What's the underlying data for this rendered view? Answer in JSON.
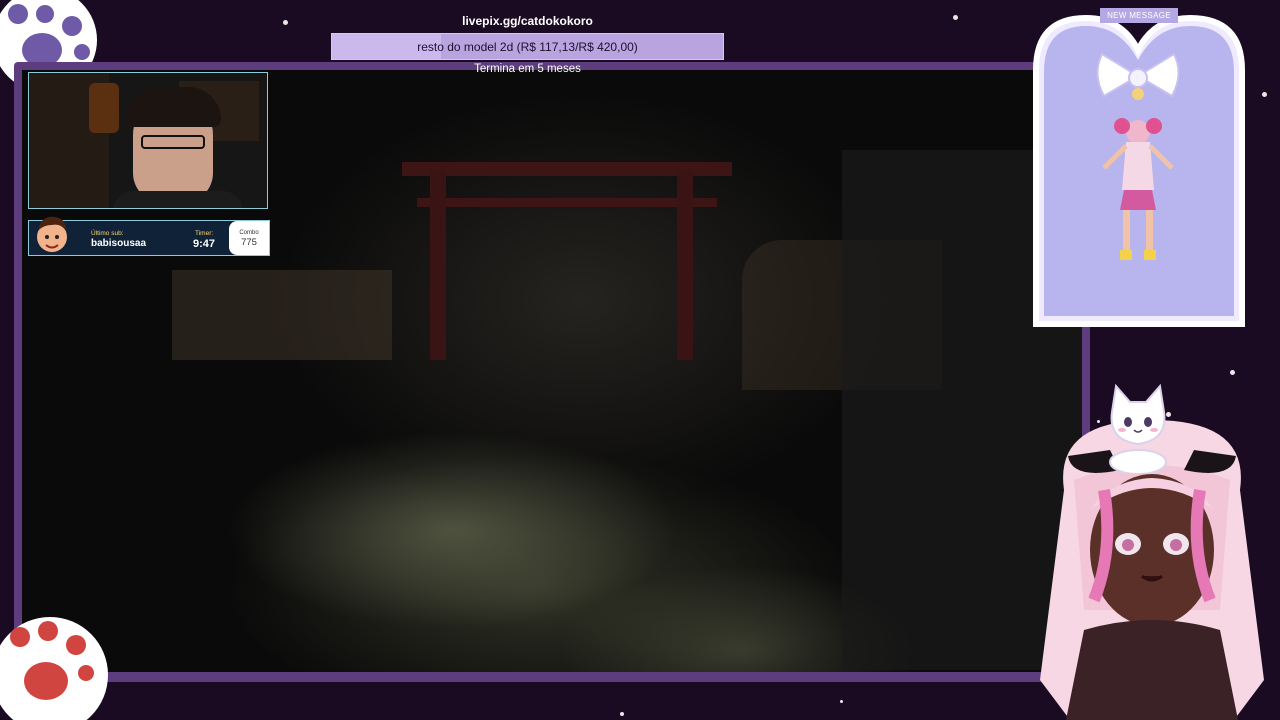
{
  "goal": {
    "url": "livepix.gg/catdokokoro",
    "label": "resto do model 2d (R$ 117,13/R$ 420,00)",
    "current": 117.13,
    "target": 420.0,
    "ends": "Termina em 5 meses"
  },
  "sub_widget": {
    "label": "Último sub:",
    "name": "babisousaa",
    "timer_label": "Timer:",
    "timer_value": "9:47",
    "combo_label": "Combo",
    "combo_value": "775"
  },
  "message_card": {
    "badge": "NEW MESSAGE"
  },
  "colors": {
    "frame": "#5d3d7e",
    "goal_bar": "#b9a4e0",
    "card_bg": "#b8b4ee",
    "sub_border": "#8ecbd8"
  },
  "icons": [
    "paw-icon",
    "paw-icon",
    "cat-icon",
    "bow-icon",
    "star-icon"
  ]
}
